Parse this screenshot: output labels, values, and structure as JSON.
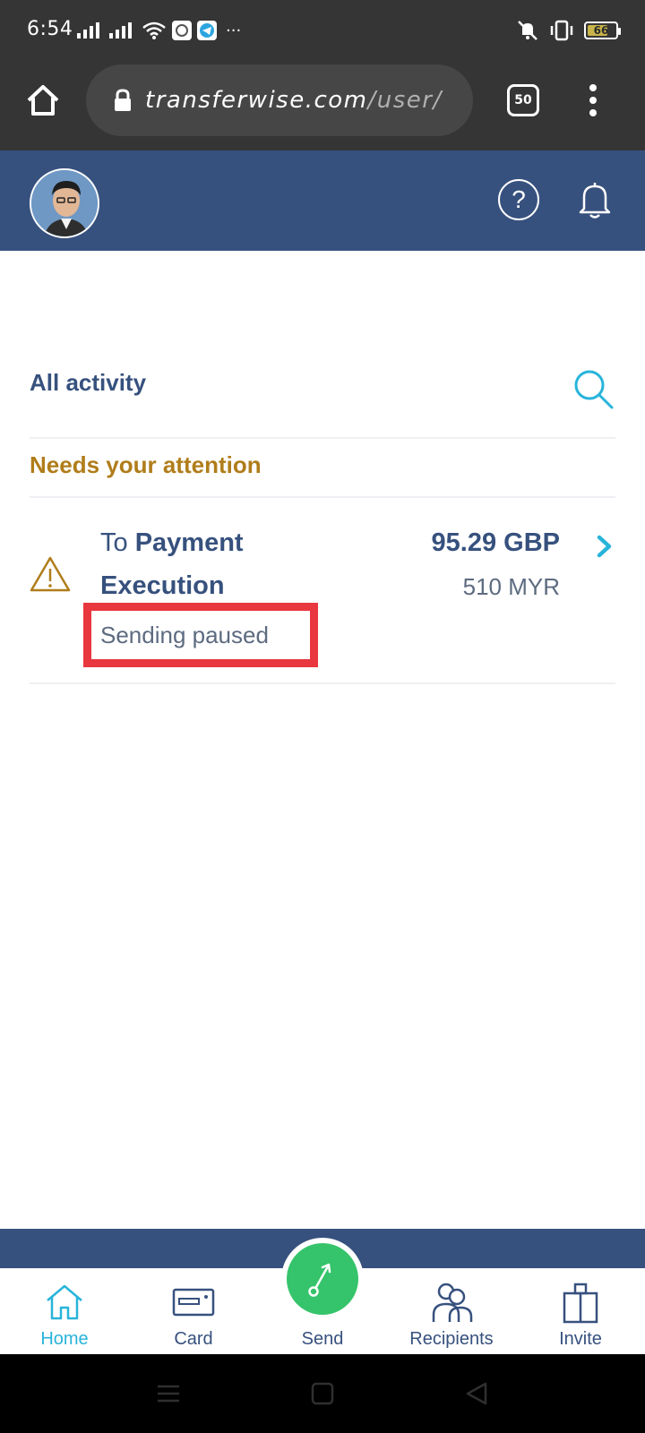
{
  "status_bar": {
    "time": "6:54",
    "battery": "66",
    "icons": [
      "signal-icon",
      "signal-icon",
      "wifi-icon",
      "notification-icon",
      "telegram-icon",
      "more-dots-icon",
      "mute-icon",
      "vibrate-icon",
      "battery-icon"
    ],
    "more": "···"
  },
  "browser": {
    "url_domain": "transferwise.com",
    "url_path": "/user/",
    "tabs_count": "50"
  },
  "header": {
    "avatar_alt": "profile photo",
    "help_symbol": "?"
  },
  "content": {
    "activity_title": "All activity",
    "attention_title": "Needs your attention",
    "transfer": {
      "recipient_prefix": "To ",
      "recipient_name_line1": "Payment",
      "recipient_name_line2": "Execution",
      "amount_primary": "95.29 GBP",
      "amount_secondary": "510 MYR",
      "status": "Sending paused"
    }
  },
  "bottom_nav": {
    "items": [
      {
        "label": "Home",
        "icon": "home-icon",
        "active": true
      },
      {
        "label": "Card",
        "icon": "card-icon",
        "active": false
      },
      {
        "label": "Send",
        "icon": "send-icon",
        "active": false
      },
      {
        "label": "Recipients",
        "icon": "recipients-icon",
        "active": false
      },
      {
        "label": "Invite",
        "icon": "gift-icon",
        "active": false
      }
    ]
  },
  "colors": {
    "header_bg": "#37517e",
    "accent": "#28b4da",
    "warning": "#b07d1a",
    "send_green": "#35c46b",
    "highlight_red": "#e8373e"
  }
}
